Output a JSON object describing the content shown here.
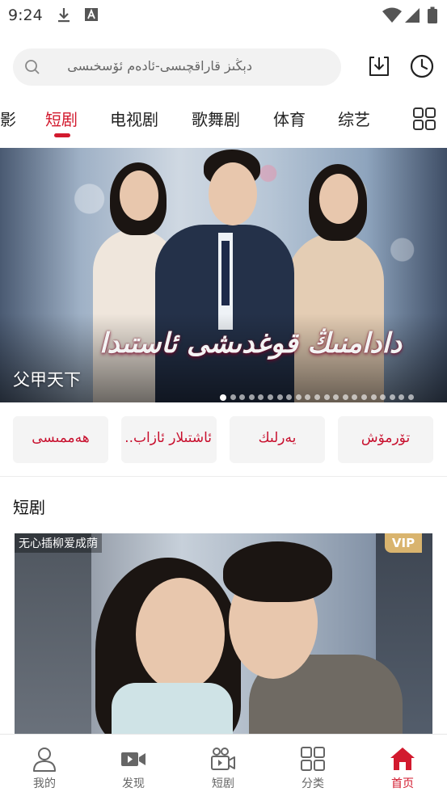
{
  "status_bar": {
    "time": "9:24"
  },
  "search": {
    "text": "دېڭىز قاراقچىسى-ئادەم ئۆسخىسى"
  },
  "tabs": [
    {
      "label": "影"
    },
    {
      "label": "短剧",
      "active": true
    },
    {
      "label": "电视剧"
    },
    {
      "label": "歌舞剧"
    },
    {
      "label": "体育"
    },
    {
      "label": "综艺"
    }
  ],
  "banner": {
    "logo_text": "دادامنىڭ قوغدىشى ئاستىدا",
    "title": "父甲天下",
    "slide_count": 21,
    "active_slide": 1
  },
  "quick_buttons": [
    {
      "label": "ھەممىسى"
    },
    {
      "label": "ئاشتىلار ئازاب..."
    },
    {
      "label": "يەرلىك"
    },
    {
      "label": "تۆرمۆش"
    }
  ],
  "section": {
    "title": "短剧",
    "card_title": "无心插柳爱成荫",
    "card_badge": "VIP"
  },
  "bottom_nav": [
    {
      "label": "我的",
      "icon": "person-icon"
    },
    {
      "label": "发现",
      "icon": "video-camera-icon"
    },
    {
      "label": "短剧",
      "icon": "clapper-icon"
    },
    {
      "label": "分类",
      "icon": "grid-icon"
    },
    {
      "label": "首页",
      "icon": "home-icon",
      "active": true
    }
  ],
  "colors": {
    "accent": "#d21a2e",
    "vip": "#d9b46e"
  }
}
